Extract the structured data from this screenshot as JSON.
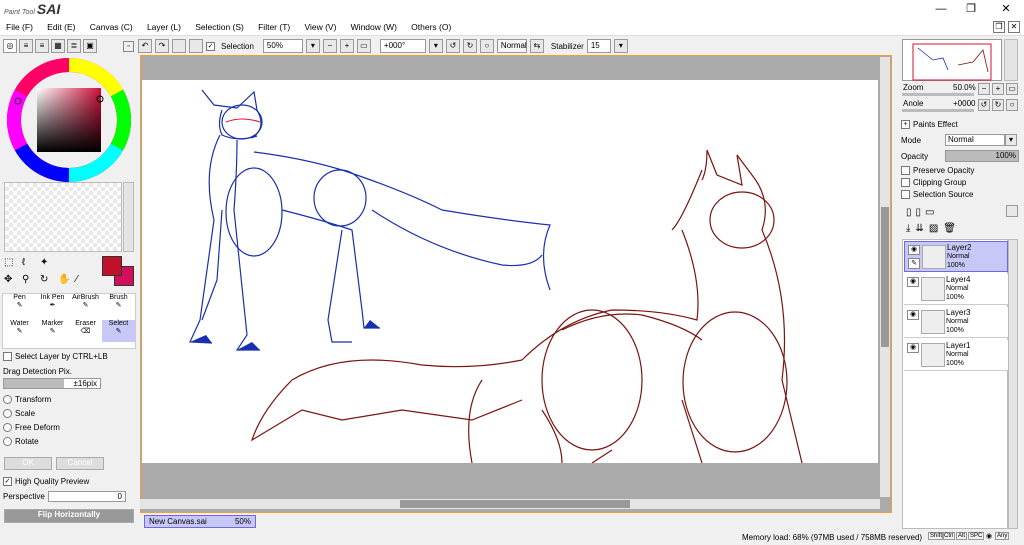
{
  "app": {
    "logo_small": "Paint Tool",
    "logo_big": "SAI"
  },
  "window_controls": {
    "minimize": "—",
    "restore": "❐",
    "close": "✕"
  },
  "menu": [
    "File (F)",
    "Edit (E)",
    "Canvas (C)",
    "Layer (L)",
    "Selection (S)",
    "Filter (T)",
    "View (V)",
    "Window (W)",
    "Others (O)"
  ],
  "toolbar": {
    "selection_label": "Selection",
    "zoom": "50%",
    "angle": "+000°",
    "blend": "Normal",
    "stabilizer_label": "Stabilizer",
    "stabilizer_value": "15"
  },
  "tools": {
    "select_layer": "Select Layer by CTRL+LB",
    "drag_detection": "Drag Detection Pix.",
    "drag_value": "±16pix",
    "transform": "Transform",
    "scale": "Scale",
    "free_deform": "Free Deform",
    "rotate": "Rotate",
    "ok": "OK",
    "cancel": "Cancel",
    "hq_preview": "High Quality Preview",
    "perspective": "Perspective",
    "perspective_value": "0",
    "flip_h": "Flip Horizontally",
    "brushes": [
      "Pen",
      "Ink Pen",
      "AirBrush",
      "Brush",
      "Water",
      "Marker",
      "Eraser",
      "Select"
    ]
  },
  "navigator": {
    "zoom_label": "Zoom",
    "zoom_value": "50.0%",
    "angle_label": "Anole",
    "angle_value": "+0000"
  },
  "paints_effect": {
    "title": "Paints Effect",
    "mode_label": "Mode",
    "mode_value": "Normal",
    "opacity_label": "Opacity",
    "opacity_value": "100%",
    "preserve": "Preserve Opacity",
    "clipping": "Clipping Group",
    "selection_source": "Selection Source"
  },
  "layers": [
    {
      "name": "Layer2",
      "mode": "Normal",
      "opacity": "100%",
      "selected": true
    },
    {
      "name": "Layer4",
      "mode": "Normal",
      "opacity": "100%",
      "selected": false
    },
    {
      "name": "Layer3",
      "mode": "Normal",
      "opacity": "100%",
      "selected": false
    },
    {
      "name": "Layer1",
      "mode": "Normal",
      "opacity": "100%",
      "selected": false
    }
  ],
  "tab": {
    "name": "New Canvas.sai",
    "zoom": "50%"
  },
  "status": {
    "memory": "Memory load: 68% (97MB used / 758MB reserved)",
    "keys": [
      "Shift",
      "Ctrl",
      "Alt",
      "SPC",
      "Any"
    ]
  },
  "colors": {
    "primary": "#c0102a",
    "secondary": "#d0105a",
    "sketch_blue": "#1a2fb0",
    "sketch_red": "#7a1410"
  }
}
